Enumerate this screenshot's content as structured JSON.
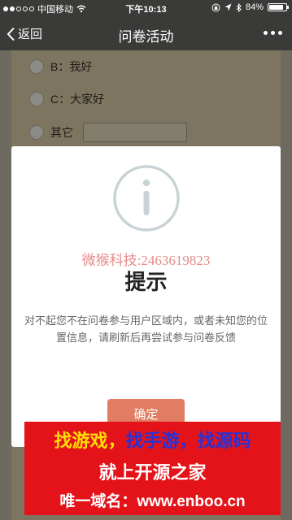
{
  "status_bar": {
    "carrier": "中国移动",
    "time": "下午10:13",
    "battery_percent": "84%",
    "battery_level": 0.84,
    "icons": [
      "signal-dots-icon",
      "wifi-icon",
      "lock-rotation-icon",
      "location-arrow-icon",
      "bluetooth-icon",
      "battery-icon"
    ]
  },
  "nav": {
    "back_label": "返回",
    "title": "问卷活动",
    "more_icon": "more-dots-icon"
  },
  "survey": {
    "options": [
      {
        "label": "B：我好"
      },
      {
        "label": "C：大家好"
      },
      {
        "label": "其它"
      }
    ]
  },
  "dialog": {
    "icon": "info-icon",
    "watermark": "微猴科技:2463619823",
    "title": "提示",
    "message": "对不起您不在问卷参与用户区域内，或者未知您的位置信息，请刷新后再尝试参与问卷反馈",
    "confirm_label": "确定"
  },
  "banner": {
    "part1": "找游戏，",
    "part2": "找手游，",
    "part3": "找源码",
    "line2": "就上开源之家",
    "line3": "唯一域名：www.enboo.cn"
  },
  "colors": {
    "nav_bg": "#3a3a38",
    "overlay_bg": "#6e6a5f",
    "confirm_bg": "#e07d62",
    "banner_bg": "#e4131a",
    "banner_yellow": "#ffe000",
    "banner_blue": "#2732d6"
  }
}
